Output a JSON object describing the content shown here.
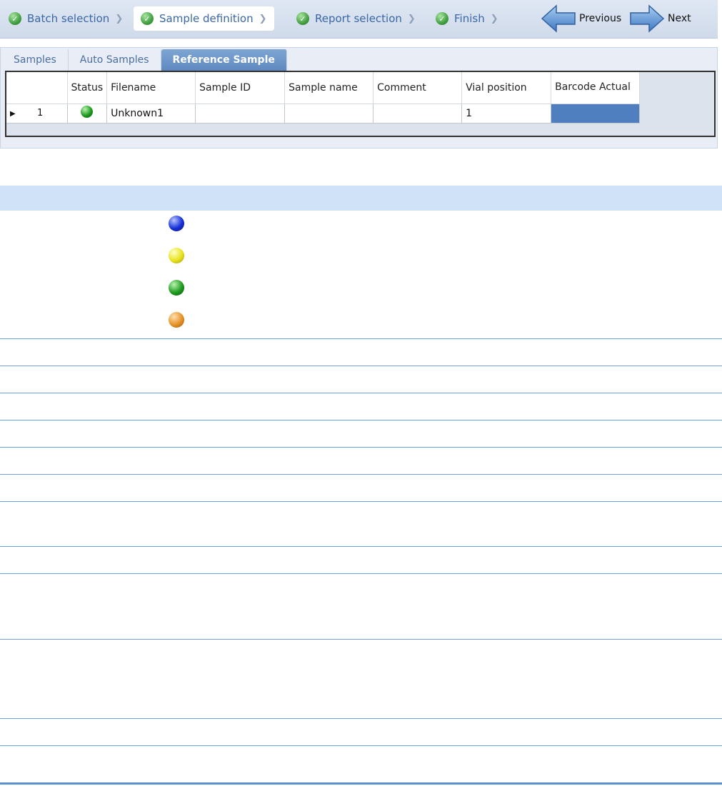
{
  "wizard": {
    "steps": [
      {
        "label": "Batch selection",
        "state": "complete"
      },
      {
        "label": "Sample definition",
        "state": "active"
      },
      {
        "label": "Report selection",
        "state": "complete"
      },
      {
        "label": "Finish",
        "state": "complete"
      }
    ],
    "previous_label": "Previous",
    "next_label": "Next"
  },
  "tabs": [
    {
      "label": "Samples",
      "active": false
    },
    {
      "label": "Auto Samples",
      "active": false
    },
    {
      "label": "Reference Sample",
      "active": true
    }
  ],
  "grid": {
    "columns": [
      "Status",
      "Filename",
      "Sample ID",
      "Sample name",
      "Comment",
      "Vial position",
      "Barcode Actual"
    ],
    "rows": [
      {
        "index": "1",
        "status_icon": "green-status-orb",
        "filename": "Unknown1",
        "sample_id": "",
        "sample_name": "",
        "comment": "",
        "vial_position": "1",
        "barcode_actual": ""
      }
    ]
  },
  "legend": {
    "icons": [
      "blue-status-orb",
      "yellow-status-orb",
      "green-status-orb",
      "orange-status-orb"
    ]
  },
  "colors": {
    "accent": "#5f89bf",
    "section_header": "#cfe2f8",
    "divider": "#6f9fd8",
    "selected_cell": "#4f7fbe"
  }
}
